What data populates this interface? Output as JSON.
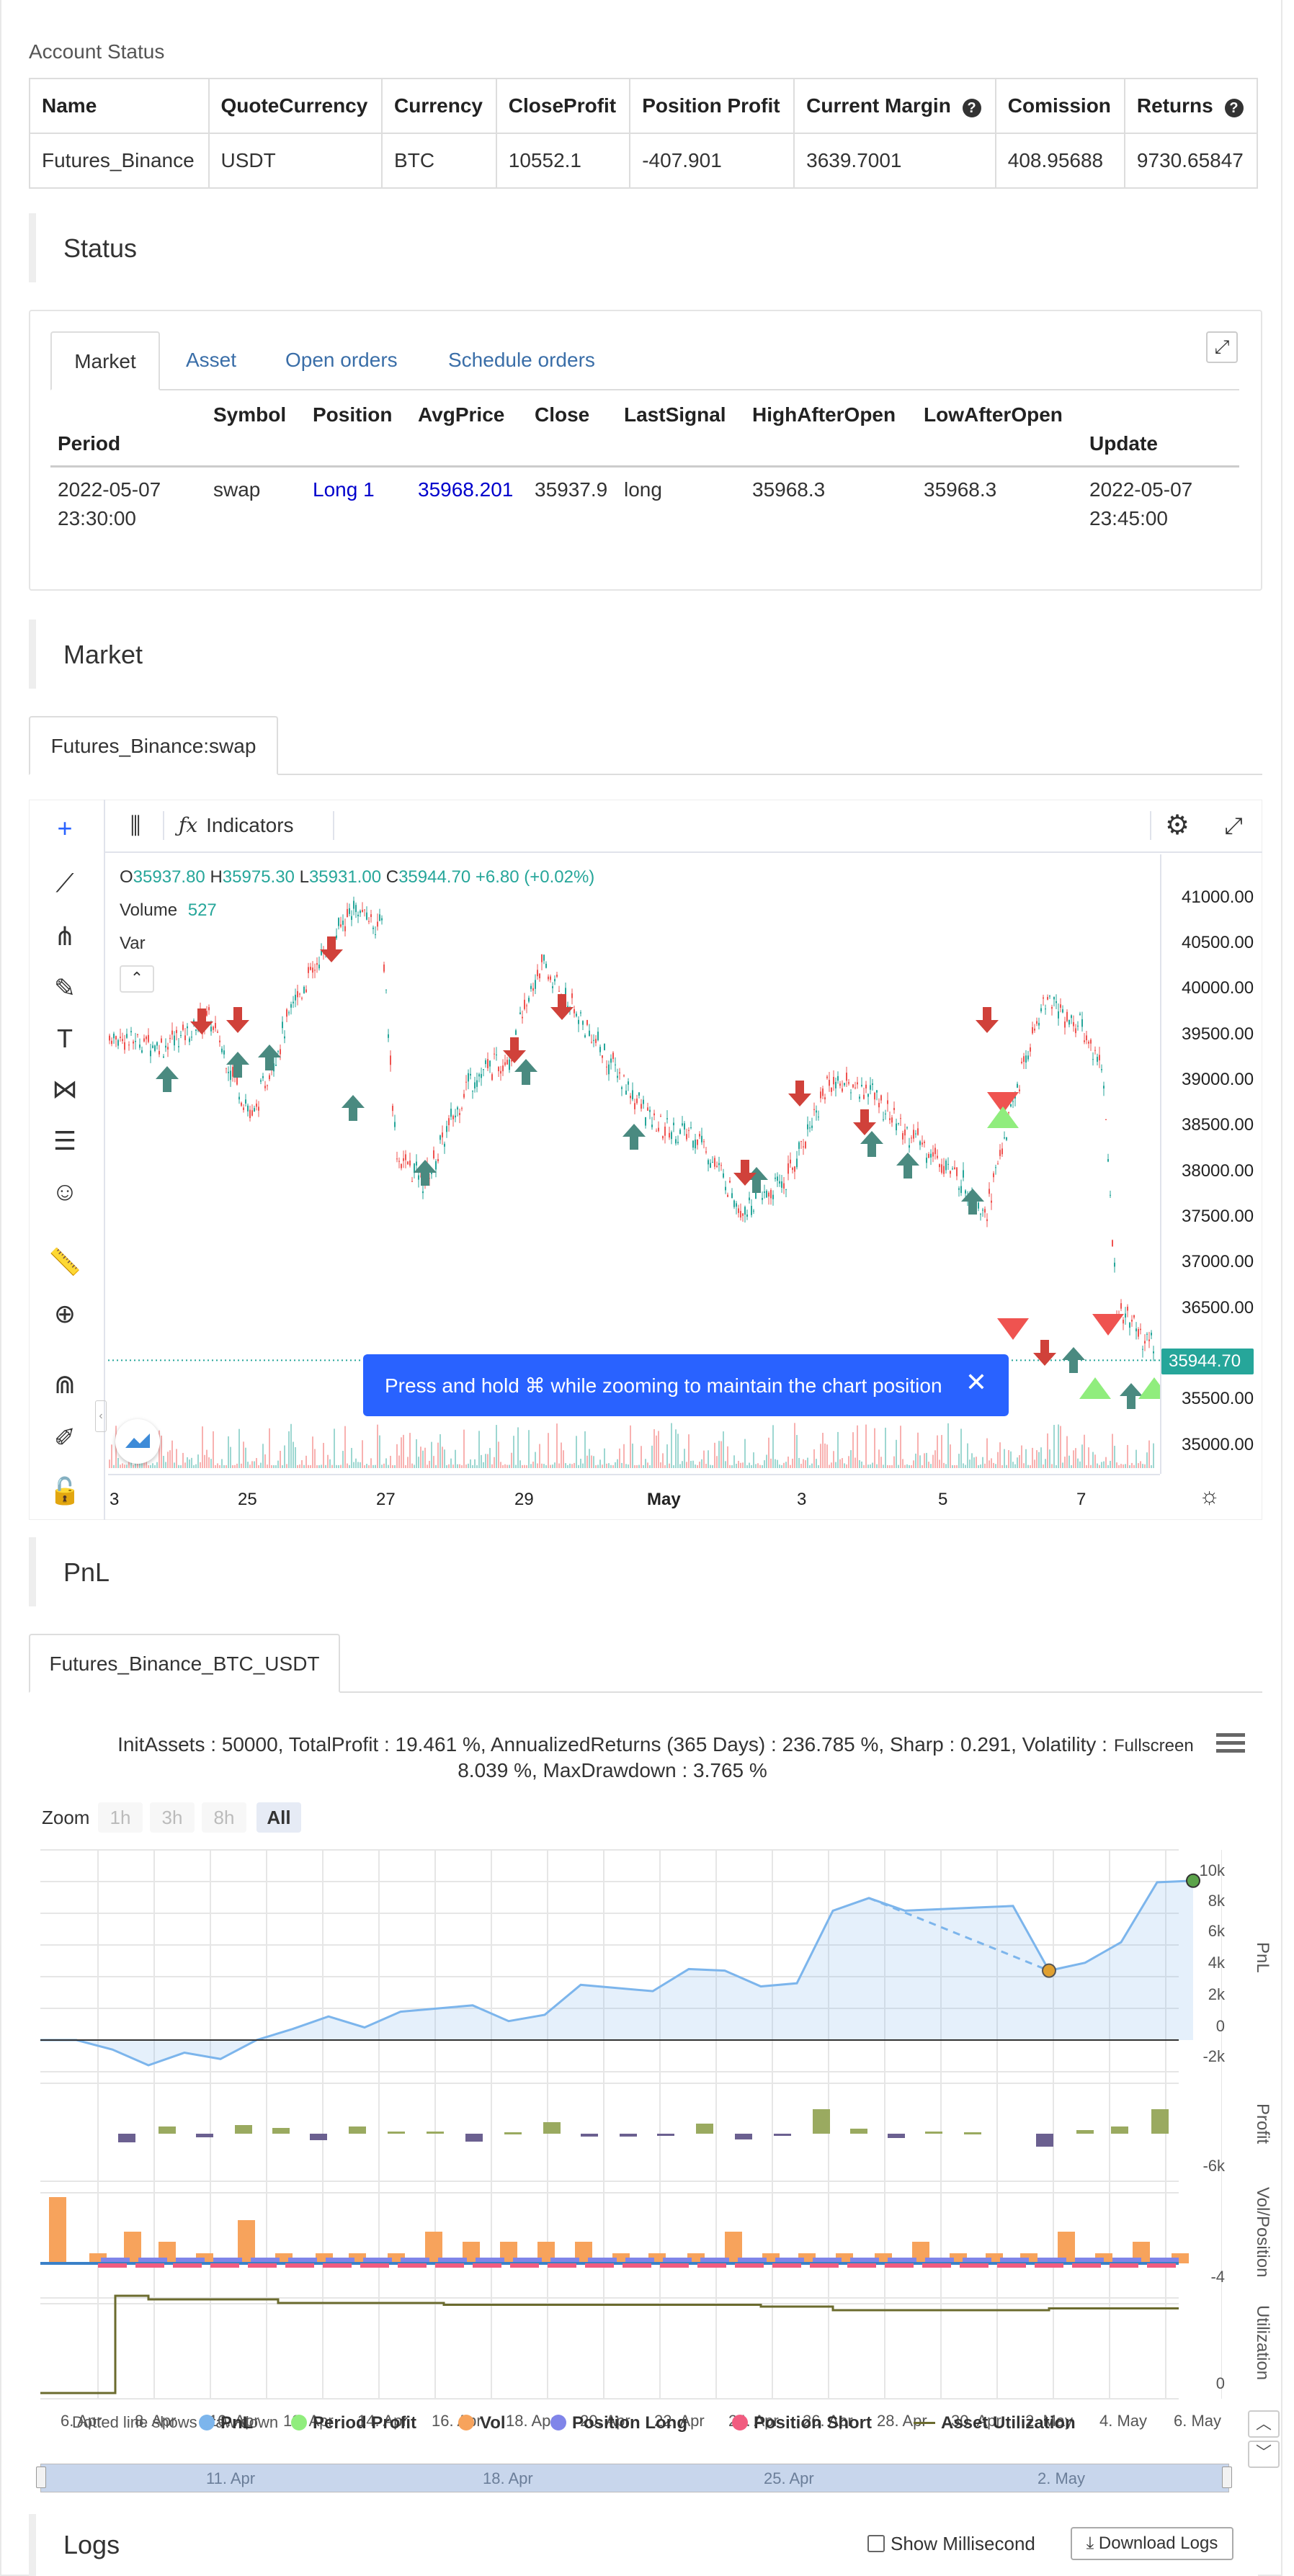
{
  "account": {
    "title": "Account Status",
    "headers": [
      "Name",
      "QuoteCurrency",
      "Currency",
      "CloseProfit",
      "Position Profit",
      "Current Margin",
      "Comission",
      "Returns"
    ],
    "row": [
      "Futures_Binance",
      "USDT",
      "BTC",
      "10552.1",
      "-407.901",
      "3639.7001",
      "408.95688",
      "9730.65847"
    ]
  },
  "status": {
    "title": "Status",
    "tabs": [
      "Market",
      "Asset",
      "Open orders",
      "Schedule orders"
    ],
    "headers": [
      "Period",
      "Symbol",
      "Position",
      "AvgPrice",
      "Close",
      "LastSignal",
      "HighAfterOpen",
      "LowAfterOpen",
      "Update"
    ],
    "row": {
      "period_date": "2022-05-07",
      "period_time": "23:30:00",
      "symbol": "swap",
      "position": "Long 1",
      "avg_price": "35968.201",
      "close": "35937.9",
      "last_signal": "long",
      "high_after_open": "35968.3",
      "low_after_open": "35968.3",
      "update_date": "2022-05-07",
      "update_time": "23:45:00"
    },
    "colors": {
      "position": "#0000cc",
      "avg_price": "#0000cc"
    }
  },
  "market": {
    "title": "Market",
    "tab": "Futures_Binance:swap",
    "toolbar_indicators": "Indicators",
    "ohlc": {
      "o_label": "O",
      "o": "35937.80",
      "h_label": "H",
      "h": "35975.30",
      "l_label": "L",
      "l": "35931.00",
      "c_label": "C",
      "c": "35944.70",
      "change": "+6.80 (+0.02%)"
    },
    "volume_label": "Volume",
    "volume_value": "527",
    "var_label": "Var",
    "price_ticks": [
      "41000.00",
      "40500.00",
      "40000.00",
      "39500.00",
      "39000.00",
      "38500.00",
      "38000.00",
      "37500.00",
      "37000.00",
      "36500.00",
      "35500.00",
      "35000.00"
    ],
    "last_price": "35944.70",
    "x_ticks": [
      "3",
      "25",
      "27",
      "29",
      "May",
      "3",
      "5",
      "7"
    ],
    "toast": "Press and hold ⌘ while zooming to maintain the chart position",
    "colors": {
      "up": "#26a69a",
      "down": "#ef5350",
      "arrow_up": "#4a8a80",
      "arrow_down": "#d0413a"
    }
  },
  "pnl": {
    "title": "PnL",
    "tab": "Futures_Binance_BTC_USDT",
    "summary_line1": "InitAssets : 50000, TotalProfit : 19.461 %, AnnualizedReturns (365 Days) : 236.785 %, Sharp : 0.291, Volatility :",
    "summary_line2": "8.039 %, MaxDrawdown : 3.765 %",
    "fullscreen": "Fullscreen",
    "zoom_label": "Zoom",
    "zoom_buttons": [
      "1h",
      "3h",
      "8h",
      "All"
    ],
    "pnl_ticks": [
      "10k",
      "8k",
      "6k",
      "4k",
      "2k",
      "0",
      "-2k"
    ],
    "profit_tick": "-6k",
    "vol_tick": "-4",
    "util_tick": "0",
    "axis_titles": [
      "PnL",
      "Profit",
      "Vol/Position",
      "Utilization"
    ],
    "x_ticks": [
      "6. Apr",
      "8. Apr",
      "10. Apr",
      "12. Apr",
      "14. Apr",
      "16. Apr",
      "18. Apr",
      "20. Apr",
      "22. Apr",
      "24. Apr",
      "26. Apr",
      "28. Apr",
      "30. Apr",
      "2. May",
      "4. May",
      "6. May"
    ],
    "dotted_note": "Dotted line shows draw down",
    "legend": [
      "PnL",
      "Period Profit",
      "Vol",
      "Position Long",
      "Position Short",
      "Asset Utilization"
    ],
    "navigator_ticks": [
      "11. Apr",
      "18. Apr",
      "25. Apr",
      "2. May"
    ],
    "colors": {
      "pnl": "#7cb5ec",
      "period_profit": "#90ed7d",
      "vol": "#f7a35c",
      "position_long": "#8085e9",
      "position_short": "#f15c80",
      "asset_utilization": "#6b6b2e"
    }
  },
  "logs": {
    "title": "Logs",
    "show_ms": "Show Millisecond",
    "download": "Download Logs"
  }
}
